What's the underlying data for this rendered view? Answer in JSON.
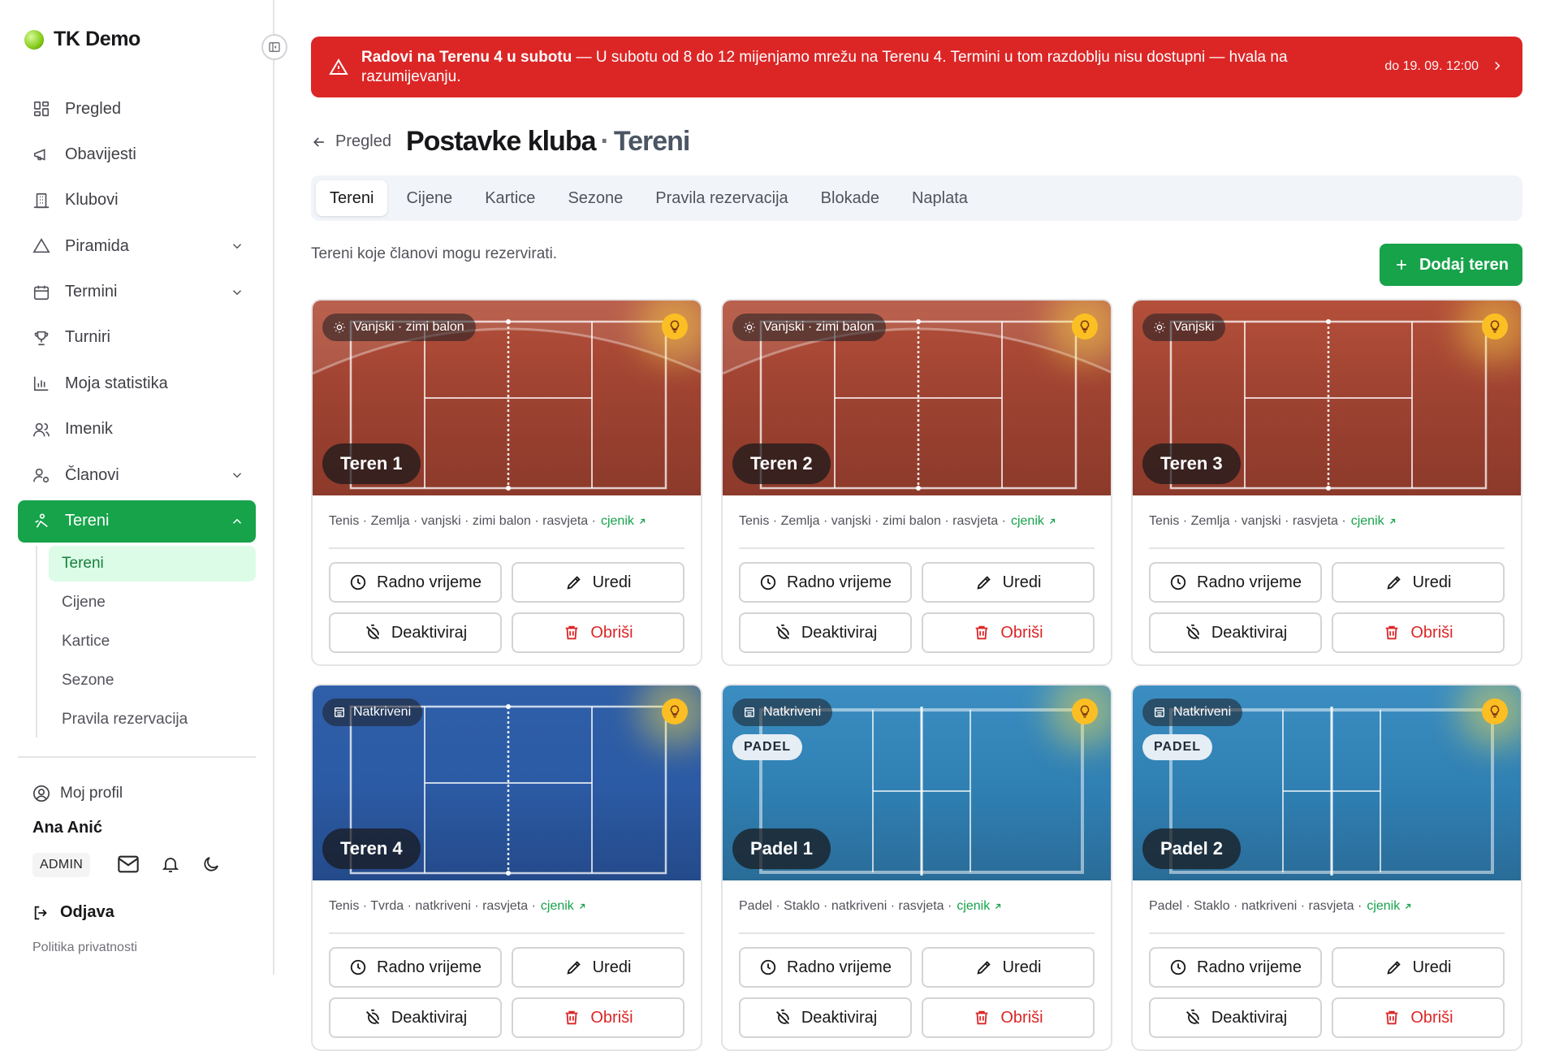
{
  "app": {
    "name": "TK Demo"
  },
  "sidebar": {
    "items": [
      {
        "label": "Pregled"
      },
      {
        "label": "Obavijesti"
      },
      {
        "label": "Klubovi"
      },
      {
        "label": "Piramida"
      },
      {
        "label": "Termini"
      },
      {
        "label": "Turniri"
      },
      {
        "label": "Moja statistika"
      },
      {
        "label": "Imenik"
      },
      {
        "label": "Članovi"
      },
      {
        "label": "Tereni"
      }
    ],
    "subitems": [
      {
        "label": "Tereni"
      },
      {
        "label": "Cijene"
      },
      {
        "label": "Kartice"
      },
      {
        "label": "Sezone"
      },
      {
        "label": "Pravila rezervacija"
      }
    ],
    "profile_label": "Moj profil",
    "user_name": "Ana Anić",
    "role": "ADMIN",
    "logout_label": "Odjava",
    "privacy_label": "Politika privatnosti"
  },
  "alert": {
    "title": "Radovi na Terenu 4 u subotu",
    "message": " — U subotu od 8 do 12 mijenjamo mrežu na Terenu 4. Termini u tom razdoblju nisu dostupni — hvala na razumijevanju.",
    "until": "do 19. 09. 12:00"
  },
  "header": {
    "back_label": "Pregled",
    "title": "Postavke kluba",
    "separator": "·",
    "subtitle": "Tereni"
  },
  "tabs": [
    {
      "label": "Tereni"
    },
    {
      "label": "Cijene"
    },
    {
      "label": "Kartice"
    },
    {
      "label": "Sezone"
    },
    {
      "label": "Pravila rezervacija"
    },
    {
      "label": "Blokade"
    },
    {
      "label": "Naplata"
    }
  ],
  "description": "Tereni koje članovi mogu rezervirati.",
  "add_button": "Dodaj teren",
  "buttons": {
    "hours": "Radno vrijeme",
    "edit": "Uredi",
    "deactivate": "Deaktiviraj",
    "delete": "Obriši"
  },
  "price_link": "cjenik",
  "courts": [
    {
      "name": "Teren 1",
      "chip": "Vanjski · zimi balon",
      "info": "Tenis · Zemlja · vanjski · zimi balon · rasvjeta ·"
    },
    {
      "name": "Teren 2",
      "chip": "Vanjski · zimi balon",
      "info": "Tenis · Zemlja · vanjski · zimi balon · rasvjeta ·"
    },
    {
      "name": "Teren 3",
      "chip": "Vanjski",
      "info": "Tenis · Zemlja · vanjski · rasvjeta ·"
    },
    {
      "name": "Teren 4",
      "chip": "Natkriveni",
      "info": "Tenis · Tvrda · natkriveni · rasvjeta ·"
    },
    {
      "name": "Padel 1",
      "chip": "Natkriveni",
      "badge": "PADEL",
      "info": "Padel · Staklo · natkriveni · rasvjeta ·"
    },
    {
      "name": "Padel 2",
      "chip": "Natkriveni",
      "badge": "PADEL",
      "info": "Padel · Staklo · natkriveni · rasvjeta ·"
    }
  ],
  "colors": {
    "accent": "#16a34a",
    "alert": "#dc2626",
    "clay": "#a04332",
    "hard": "#2c5ba5",
    "padel": "#2f7fb2"
  }
}
